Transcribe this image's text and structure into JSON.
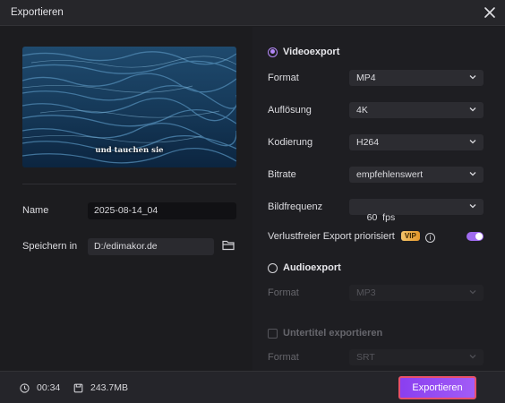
{
  "window": {
    "title": "Exportieren"
  },
  "preview": {
    "caption": "und tauchen sie"
  },
  "left": {
    "name_label": "Name",
    "name_value": "2025-08-14_04",
    "save_label": "Speichern in",
    "save_value": "D:/edimakor.de"
  },
  "video": {
    "heading": "Videoexport",
    "rows": [
      {
        "label": "Format",
        "value": "MP4"
      },
      {
        "label": "Auflösung",
        "value": "4K"
      },
      {
        "label": "Kodierung",
        "value": "H264"
      },
      {
        "label": "Bitrate",
        "value": "empfehlenswert"
      },
      {
        "label": "Bildfrequenz",
        "value": "60  fps"
      }
    ],
    "lossless_label": "Verlustfreier Export priorisiert",
    "vip_badge": "VIP",
    "info_glyph": "i",
    "lossless_on": true
  },
  "audio": {
    "heading": "Audioexport",
    "format_label": "Format",
    "format_value": "MP3"
  },
  "subtitle": {
    "heading": "Untertitel exportieren",
    "format_label": "Format",
    "format_value": "SRT"
  },
  "footer": {
    "duration": "00:34",
    "size": "243.7MB",
    "export_label": "Exportieren"
  },
  "colors": {
    "accent": "#a06cf0",
    "highlight_border": "#e8506a"
  },
  "icons": [
    "close-icon",
    "folder-icon",
    "chevron-down-icon",
    "clock-icon",
    "file-size-icon",
    "info-icon"
  ]
}
